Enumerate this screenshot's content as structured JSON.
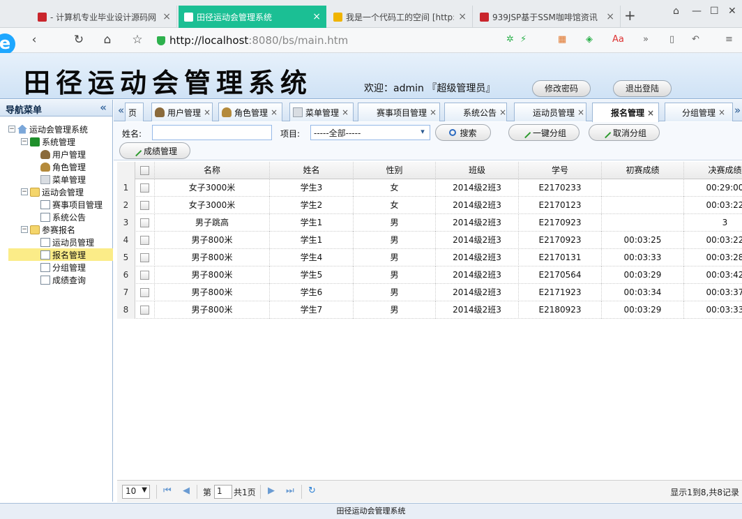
{
  "browser": {
    "tabs": [
      {
        "title": "- 计算机专业毕业设计源码网",
        "icon_color": "#c9252c"
      },
      {
        "title": "田径运动会管理系统",
        "icon_color": "#ffffff"
      },
      {
        "title": "我是一个代码工的空间 [http:",
        "icon_color": "#f0b400"
      },
      {
        "title": "939JSP基于SSM咖啡馆资讯",
        "icon_color": "#c9252c"
      }
    ],
    "url_host": "http://localhost",
    "url_path": ":8080/bs/main.htm",
    "accent": "#1bbf94"
  },
  "app": {
    "title": "田径运动会管理系统",
    "welcome": "欢迎：admin 『超级管理员』",
    "change_password": "修改密码",
    "logout": "退出登陆"
  },
  "nav": {
    "header": "导航菜单",
    "collapse": "«",
    "items": [
      {
        "label": "运动会管理系统",
        "level": 0,
        "icon": "home-icon"
      },
      {
        "label": "系统管理",
        "level": 1,
        "icon": "folder-icon"
      },
      {
        "label": "用户管理",
        "level": 2,
        "icon": "user-icon"
      },
      {
        "label": "角色管理",
        "level": 2,
        "icon": "role-icon"
      },
      {
        "label": "菜单管理",
        "level": 2,
        "icon": "menu-icon"
      },
      {
        "label": "运动会管理",
        "level": 1,
        "icon": "folder-icon"
      },
      {
        "label": "赛事项目管理",
        "level": 2,
        "icon": "doc-icon"
      },
      {
        "label": "系统公告",
        "level": 2,
        "icon": "doc-icon"
      },
      {
        "label": "参赛报名",
        "level": 1,
        "icon": "folder-icon"
      },
      {
        "label": "运动员管理",
        "level": 2,
        "icon": "doc-icon"
      },
      {
        "label": "报名管理",
        "level": 2,
        "icon": "doc-icon",
        "selected": true
      },
      {
        "label": "分组管理",
        "level": 2,
        "icon": "doc-icon"
      },
      {
        "label": "成绩查询",
        "level": 2,
        "icon": "doc-icon"
      }
    ]
  },
  "tabs": {
    "first_partial": "页",
    "items": [
      "用户管理",
      "角色管理",
      "菜单管理",
      "赛事项目管理",
      "系统公告",
      "运动员管理",
      "报名管理",
      "分组管理"
    ],
    "active": "报名管理"
  },
  "toolbar": {
    "name_label": "姓名:",
    "name_value": "",
    "project_label": "项目:",
    "project_value": "-----全部-----",
    "search": "搜索",
    "group": "一键分组",
    "ungroup": "取消分组",
    "score": "成绩管理"
  },
  "grid": {
    "columns": [
      "名称",
      "姓名",
      "性别",
      "班级",
      "学号",
      "初赛成绩",
      "决赛成绩"
    ],
    "rows": [
      [
        "1",
        "女子3000米",
        "学生3",
        "女",
        "2014级2班3",
        "E2170233",
        "",
        "00:29:00"
      ],
      [
        "2",
        "女子3000米",
        "学生2",
        "女",
        "2014级2班3",
        "E2170123",
        "",
        "00:03:22"
      ],
      [
        "3",
        "男子跳高",
        "学生1",
        "男",
        "2014级2班3",
        "E2170923",
        "",
        "3"
      ],
      [
        "4",
        "男子800米",
        "学生1",
        "男",
        "2014级2班3",
        "E2170923",
        "00:03:25",
        "00:03:22"
      ],
      [
        "5",
        "男子800米",
        "学生4",
        "男",
        "2014级2班3",
        "E2170131",
        "00:03:33",
        "00:03:28"
      ],
      [
        "6",
        "男子800米",
        "学生5",
        "男",
        "2014级2班3",
        "E2170564",
        "00:03:29",
        "00:03:42"
      ],
      [
        "7",
        "男子800米",
        "学生6",
        "男",
        "2014级2班3",
        "E2171923",
        "00:03:34",
        "00:03:37"
      ],
      [
        "8",
        "男子800米",
        "学生7",
        "男",
        "2014级2班3",
        "E2180923",
        "00:03:29",
        "00:03:33"
      ]
    ]
  },
  "pager": {
    "page_size": "10",
    "page_label": "第",
    "page_value": "1",
    "total_pages": "共1页",
    "summary": "显示1到8,共8记录"
  },
  "footer": "田径运动会管理系统"
}
